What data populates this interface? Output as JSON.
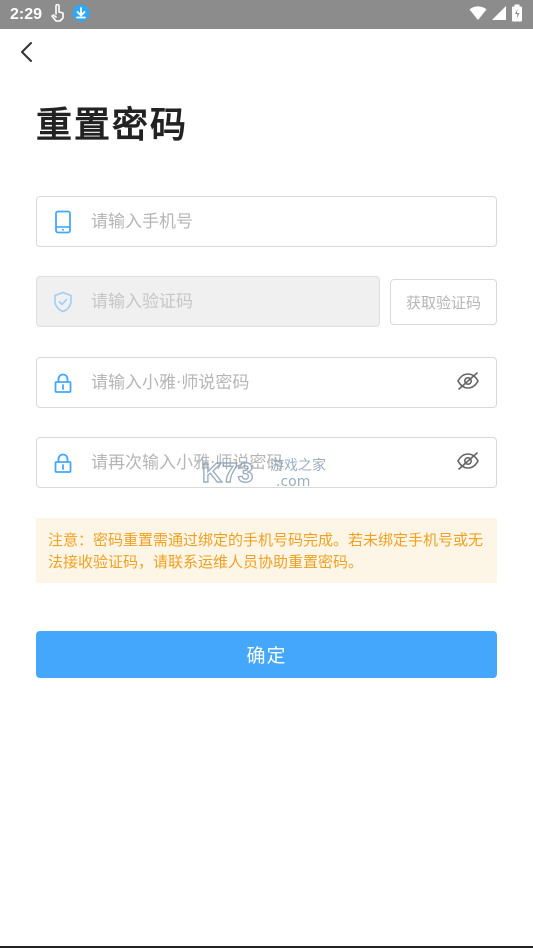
{
  "status_bar": {
    "time": "2:29"
  },
  "page": {
    "title": "重置密码"
  },
  "form": {
    "phone_placeholder": "请输入手机号",
    "code_placeholder": "请输入验证码",
    "get_code_label": "获取验证码",
    "password_placeholder": "请输入小雅·师说密码",
    "confirm_password_placeholder": "请再次输入小雅·师说密码"
  },
  "notice": {
    "text": "注意：密码重置需通过绑定的手机号码完成。若未绑定手机号或无法接收验证码，请联系运维人员协助重置密码。"
  },
  "actions": {
    "confirm_label": "确定"
  },
  "watermark": {
    "brand": "K73",
    "tagline": "游戏之家",
    "domain": ".com"
  },
  "colors": {
    "primary": "#44a7fb",
    "icon": "#44a7fb",
    "notice_text": "#f0a020",
    "notice_bg": "#fdf6e7",
    "status_bar": "#8c8c8c"
  },
  "icons": {
    "back": "chevron-left-icon",
    "phone": "phone-icon",
    "code": "shield-icon",
    "lock": "lock-icon",
    "eye": "eye-off-icon"
  }
}
